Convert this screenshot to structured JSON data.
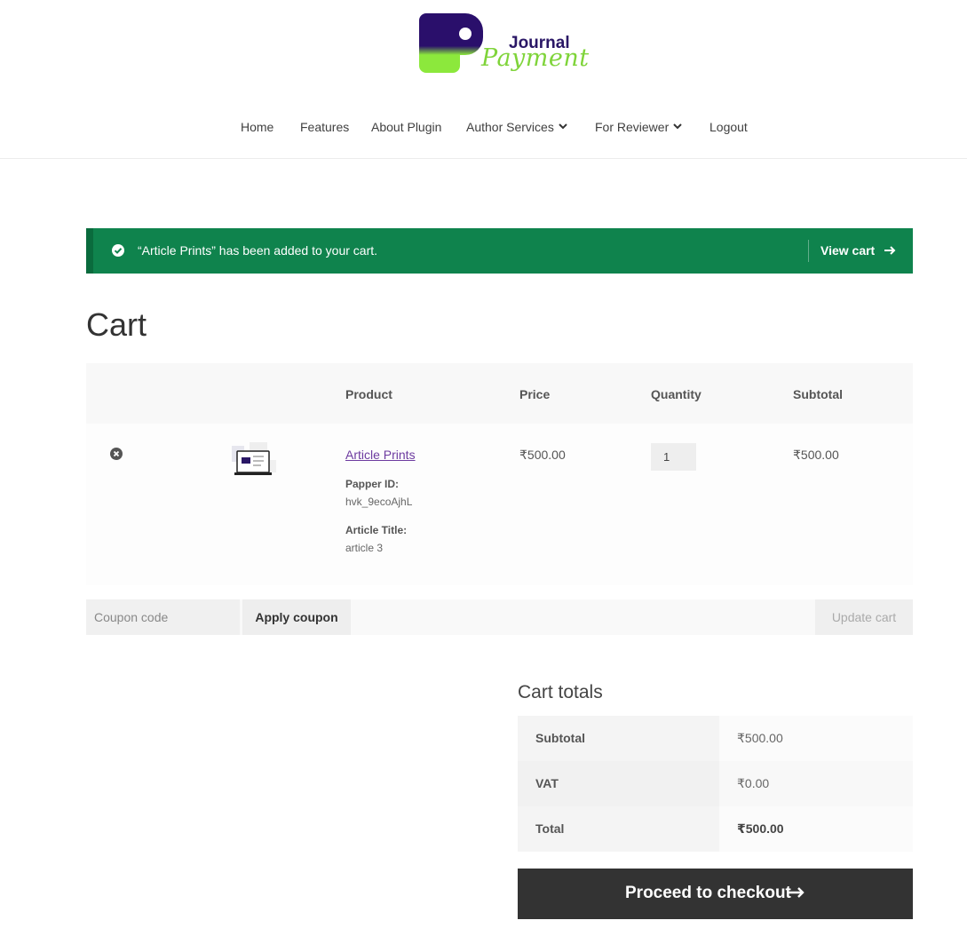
{
  "brand": {
    "word1": "Journal",
    "word2": "Payment",
    "colors": {
      "dark": "#2a1766",
      "green": "#7fd43a"
    }
  },
  "nav": {
    "items": [
      {
        "label": "Home"
      },
      {
        "label": "Features"
      },
      {
        "label": "About Plugin"
      },
      {
        "label": "Author Services"
      },
      {
        "label": "For Reviewer"
      },
      {
        "label": "Logout"
      }
    ]
  },
  "notice": {
    "message": "“Article Prints” has been added to your cart.",
    "link": "View cart",
    "color": "#0f834d"
  },
  "page": {
    "title": "Cart"
  },
  "cart": {
    "headers": {
      "product": "Product",
      "price": "Price",
      "quantity": "Quantity",
      "subtotal": "Subtotal"
    },
    "items": [
      {
        "name": "Article Prints",
        "meta": [
          {
            "label": "Papper ID:",
            "value": "hvk_9ecoAjhL"
          },
          {
            "label": "Article Title:",
            "value": "article 3"
          }
        ],
        "price": "₹500.00",
        "quantity": "1",
        "subtotal": "₹500.00"
      }
    ]
  },
  "actions": {
    "coupon_placeholder": "Coupon code",
    "apply": "Apply coupon",
    "update": "Update cart"
  },
  "totals": {
    "title": "Cart totals",
    "rows": [
      {
        "label": "Subtotal",
        "value": "₹500.00"
      },
      {
        "label": "VAT",
        "value": "₹0.00"
      },
      {
        "label": "Total",
        "value": "₹500.00"
      }
    ]
  },
  "checkout": {
    "label": "Proceed to checkout"
  }
}
